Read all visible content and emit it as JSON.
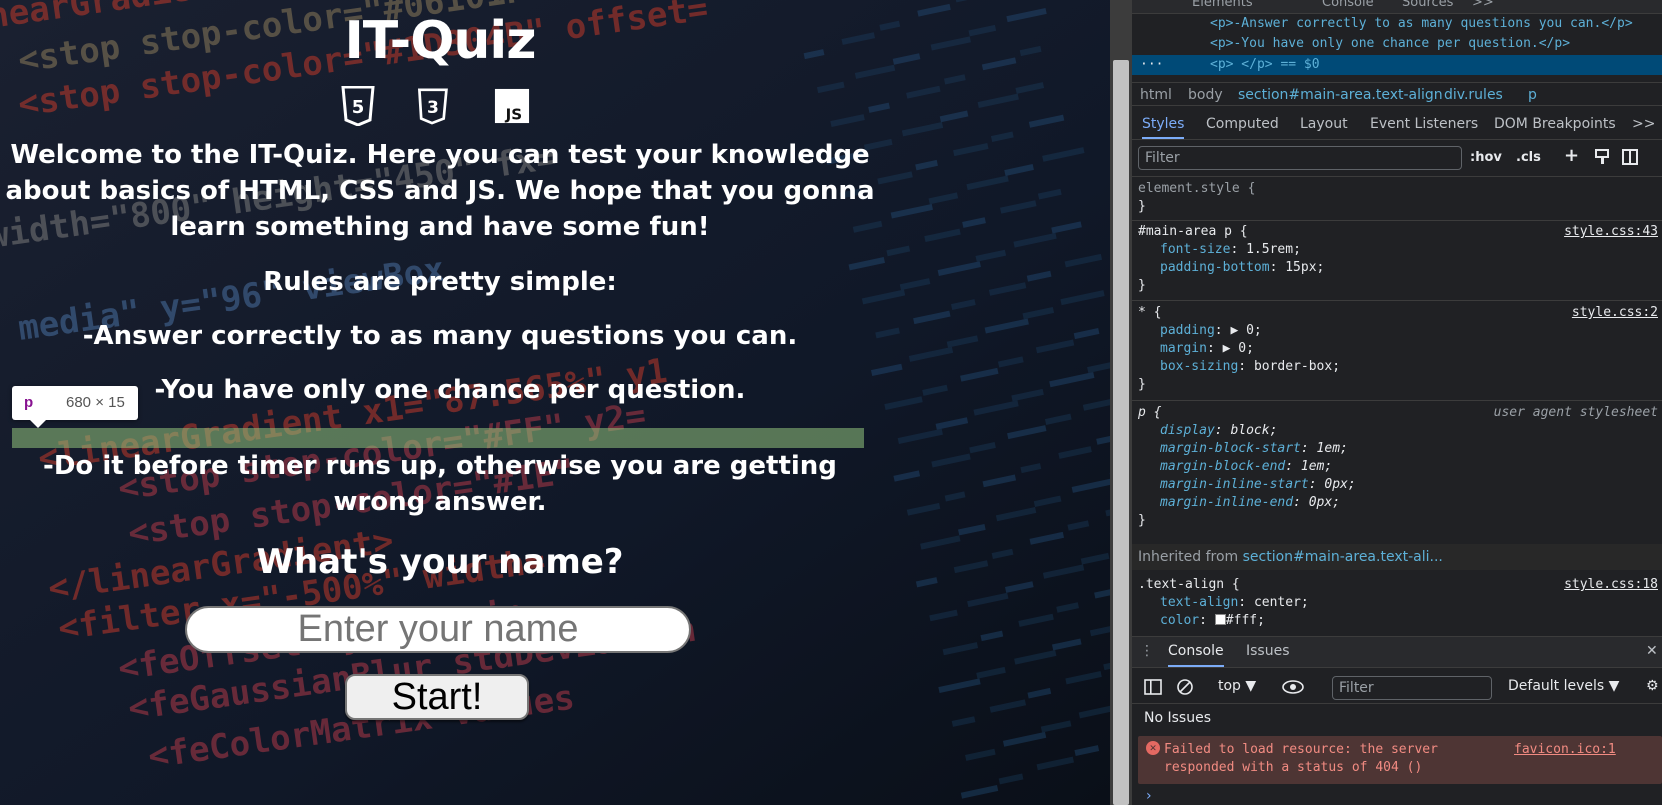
{
  "quiz": {
    "title": "IT-Quiz",
    "logos": {
      "html": "5",
      "css": "3",
      "js": "JS"
    },
    "welcome_line1": "Welcome to the IT-Quiz. Here you can test your knowledge",
    "welcome_line2": "about basics of HTML, CSS and JS. We hope that you gonna",
    "welcome_line3": "learn something and have some fun!",
    "rules_heading": "Rules are pretty simple:",
    "rule1": "-Answer correctly to as many questions you can.",
    "rule2": "-You have only one chance per question.",
    "rule3_line1": "-Do it before timer runs up, otherwise you are getting",
    "rule3_line2": "wrong answer.",
    "name_question": "What's your name?",
    "name_placeholder": "Enter your name",
    "start_label": "Start!"
  },
  "background_code": [
    "nearGradient x1=\"100%\" x2=\"100\" y2=",
    "<stop stop-color=\"#06101F\" offset=",
    "<stop stop-color=\"#1D304B\" offset=",
    "width=\"800\" height=\"450\" fx=",
    "media\" y=\"96\" viewBox",
    "<linearGradient x1=\"87.565%\" y1",
    "<stop stop-color=\"#FF\" y2=",
    "<stop stop-color=\"#1E\"",
    "</linearGradient>",
    "<filter x=\"-500%\" width=",
    "<feOffset dy=\"10\" in",
    "<feGaussianBlur stdDeviation",
    "<feColorMatrix values"
  ],
  "inspect_tooltip": {
    "tag": "p",
    "dims": "680 × 15"
  },
  "devtools": {
    "top_tabs": [
      "Elements",
      "Console",
      "Sources",
      ">>"
    ],
    "dom_lines": [
      {
        "text": "<p>-Answer correctly to as many questions you can.</p>"
      },
      {
        "text": "<p>-You have only one chance per question.</p>"
      },
      {
        "text": "<p> </p> == $0"
      }
    ],
    "dots": "···",
    "breadcrumb": [
      "html",
      "body",
      "section#main-area.text-align",
      "div.rules",
      "p"
    ],
    "style_tabs": [
      "Styles",
      "Computed",
      "Layout",
      "Event Listeners",
      "DOM Breakpoints",
      ">>"
    ],
    "filter_placeholder": "Filter",
    "hov": ":hov",
    "cls": ".cls",
    "rules": {
      "element_style": "element.style {",
      "close": "}",
      "r1_sel": "#main-area p {",
      "r1_src": "style.css:43",
      "r1_p1": "font-size",
      "r1_v1": "1.5rem;",
      "r1_p2": "padding-bottom",
      "r1_v2": "15px;",
      "r2_sel": "* {",
      "r2_src": "style.css:2",
      "r2_p1": "padding",
      "r2_v1": "▶ 0;",
      "r2_p2": "margin",
      "r2_v2": "▶ 0;",
      "r2_p3": "box-sizing",
      "r2_v3": "border-box;",
      "r3_sel": "p {",
      "r3_src": "user agent stylesheet",
      "r3_p1": "display",
      "r3_v1": "block;",
      "r3_p2": "margin-block-start",
      "r3_v2": "1em;",
      "r3_p3": "margin-block-end",
      "r3_v3": "1em;",
      "r3_p4": "margin-inline-start",
      "r3_v4": "0px;",
      "r3_p5": "margin-inline-end",
      "r3_v5": "0px;",
      "inherited_label": "Inherited from",
      "inherited_el": "section#main-area.text-ali...",
      "r4_sel": ".text-align {",
      "r4_src": "style.css:18",
      "r4_p1": "text-align",
      "r4_v1": "center;",
      "r4_p2": "color",
      "r4_v2": "#fff;"
    },
    "drawer_tabs": [
      "Console",
      "Issues"
    ],
    "console_context": "top ▼",
    "console_filter_placeholder": "Filter",
    "levels": "Default levels ▼",
    "no_issues": "No Issues",
    "error_line1": "Failed to load resource: the server",
    "error_line2": "responded with a status of 404 ()",
    "error_link": "favicon.ico:1",
    "prompt": "›"
  }
}
